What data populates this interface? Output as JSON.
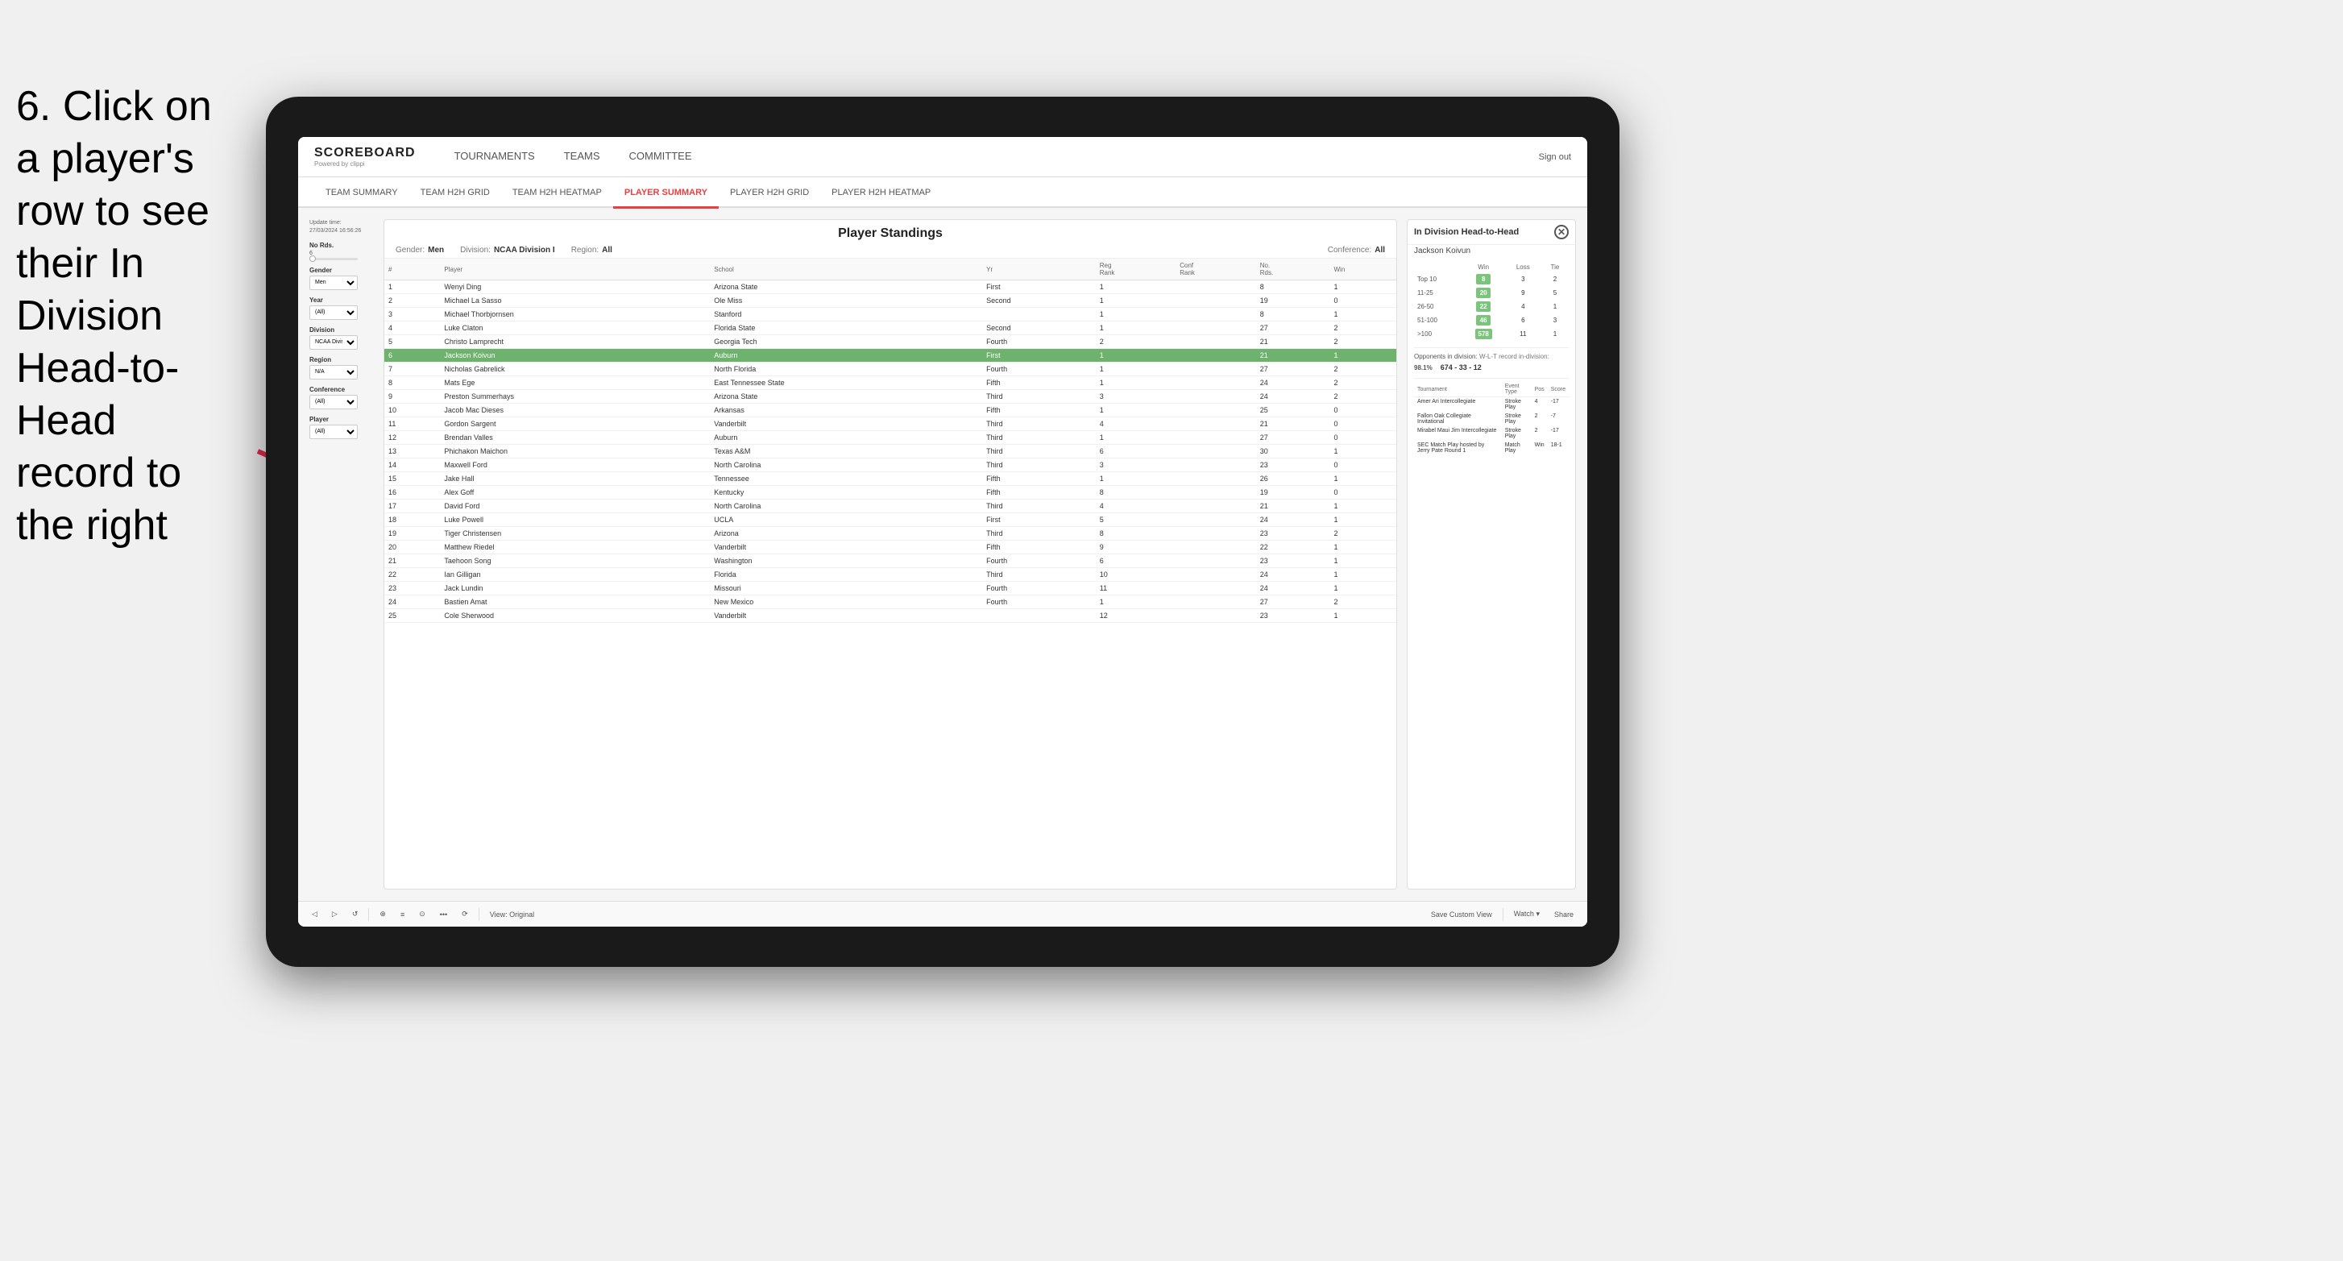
{
  "instruction": {
    "text": "6. Click on a player's row to see their In Division Head-to-Head record to the right"
  },
  "app": {
    "logo": {
      "title": "SCOREBOARD",
      "subtitle": "Powered by clippi"
    },
    "nav": {
      "items": [
        "TOURNAMENTS",
        "TEAMS",
        "COMMITTEE"
      ],
      "right": [
        "Sign out"
      ]
    },
    "sub_nav": {
      "items": [
        "TEAM SUMMARY",
        "TEAM H2H GRID",
        "TEAM H2H HEATMAP",
        "PLAYER SUMMARY",
        "PLAYER H2H GRID",
        "PLAYER H2H HEATMAP"
      ],
      "active": "PLAYER SUMMARY"
    }
  },
  "panel": {
    "title": "Player Standings",
    "update_time_label": "Update time:",
    "update_time": "27/03/2024 16:56:26",
    "filters": {
      "gender_label": "Gender:",
      "gender_value": "Men",
      "division_label": "Division:",
      "division_value": "NCAA Division I",
      "region_label": "Region:",
      "region_value": "All",
      "conference_label": "Conference:",
      "conference_value": "All"
    },
    "left_filters": {
      "no_rds_label": "No Rds.",
      "no_rds_value": "6",
      "gender_label": "Gender",
      "gender_value": "Men",
      "year_label": "Year",
      "year_value": "(All)",
      "division_label": "Division",
      "division_value": "NCAA Division I",
      "region_label": "Region",
      "region_value": "N/A",
      "conference_label": "Conference",
      "conference_value": "(All)",
      "player_label": "Player",
      "player_value": "(All)"
    },
    "table": {
      "headers": [
        "#",
        "Player",
        "School",
        "Yr",
        "Reg Rank",
        "Conf Rank",
        "No. Rds.",
        "Win"
      ],
      "rows": [
        {
          "num": 1,
          "player": "Wenyi Ding",
          "school": "Arizona State",
          "yr": "First",
          "reg_rank": 1,
          "conf_rank": "",
          "no_rds": 8,
          "win": 1
        },
        {
          "num": 2,
          "player": "Michael La Sasso",
          "school": "Ole Miss",
          "yr": "Second",
          "reg_rank": 1,
          "conf_rank": "",
          "no_rds": 19,
          "win": 0
        },
        {
          "num": 3,
          "player": "Michael Thorbjornsen",
          "school": "Stanford",
          "yr": "",
          "reg_rank": 1,
          "conf_rank": "",
          "no_rds": 8,
          "win": 1
        },
        {
          "num": 4,
          "player": "Luke Claton",
          "school": "Florida State",
          "yr": "Second",
          "reg_rank": 1,
          "conf_rank": "",
          "no_rds": 27,
          "win": 2
        },
        {
          "num": 5,
          "player": "Christo Lamprecht",
          "school": "Georgia Tech",
          "yr": "Fourth",
          "reg_rank": 2,
          "conf_rank": "",
          "no_rds": 21,
          "win": 2
        },
        {
          "num": 6,
          "player": "Jackson Koivun",
          "school": "Auburn",
          "yr": "First",
          "reg_rank": 1,
          "conf_rank": "",
          "no_rds": 21,
          "win": 1,
          "selected": true
        },
        {
          "num": 7,
          "player": "Nicholas Gabrelick",
          "school": "North Florida",
          "yr": "Fourth",
          "reg_rank": 1,
          "conf_rank": "",
          "no_rds": 27,
          "win": 2
        },
        {
          "num": 8,
          "player": "Mats Ege",
          "school": "East Tennessee State",
          "yr": "Fifth",
          "reg_rank": 1,
          "conf_rank": "",
          "no_rds": 24,
          "win": 2
        },
        {
          "num": 9,
          "player": "Preston Summerhays",
          "school": "Arizona State",
          "yr": "Third",
          "reg_rank": 3,
          "conf_rank": "",
          "no_rds": 24,
          "win": 2
        },
        {
          "num": 10,
          "player": "Jacob Mac Dieses",
          "school": "Arkansas",
          "yr": "Fifth",
          "reg_rank": 1,
          "conf_rank": "",
          "no_rds": 25,
          "win": 0
        },
        {
          "num": 11,
          "player": "Gordon Sargent",
          "school": "Vanderbilt",
          "yr": "Third",
          "reg_rank": 4,
          "conf_rank": "",
          "no_rds": 21,
          "win": 0
        },
        {
          "num": 12,
          "player": "Brendan Valles",
          "school": "Auburn",
          "yr": "Third",
          "reg_rank": 1,
          "conf_rank": "",
          "no_rds": 27,
          "win": 0
        },
        {
          "num": 13,
          "player": "Phichakon Maichon",
          "school": "Texas A&M",
          "yr": "Third",
          "reg_rank": 6,
          "conf_rank": "",
          "no_rds": 30,
          "win": 1
        },
        {
          "num": 14,
          "player": "Maxwell Ford",
          "school": "North Carolina",
          "yr": "Third",
          "reg_rank": 3,
          "conf_rank": "",
          "no_rds": 23,
          "win": 0
        },
        {
          "num": 15,
          "player": "Jake Hall",
          "school": "Tennessee",
          "yr": "Fifth",
          "reg_rank": 1,
          "conf_rank": "",
          "no_rds": 26,
          "win": 1
        },
        {
          "num": 16,
          "player": "Alex Goff",
          "school": "Kentucky",
          "yr": "Fifth",
          "reg_rank": 8,
          "conf_rank": "",
          "no_rds": 19,
          "win": 0
        },
        {
          "num": 17,
          "player": "David Ford",
          "school": "North Carolina",
          "yr": "Third",
          "reg_rank": 4,
          "conf_rank": "",
          "no_rds": 21,
          "win": 1
        },
        {
          "num": 18,
          "player": "Luke Powell",
          "school": "UCLA",
          "yr": "First",
          "reg_rank": 5,
          "conf_rank": "",
          "no_rds": 24,
          "win": 1
        },
        {
          "num": 19,
          "player": "Tiger Christensen",
          "school": "Arizona",
          "yr": "Third",
          "reg_rank": 8,
          "conf_rank": "",
          "no_rds": 23,
          "win": 2
        },
        {
          "num": 20,
          "player": "Matthew Riedel",
          "school": "Vanderbilt",
          "yr": "Fifth",
          "reg_rank": 9,
          "conf_rank": "",
          "no_rds": 22,
          "win": 1
        },
        {
          "num": 21,
          "player": "Taehoon Song",
          "school": "Washington",
          "yr": "Fourth",
          "reg_rank": 6,
          "conf_rank": "",
          "no_rds": 23,
          "win": 1
        },
        {
          "num": 22,
          "player": "Ian Gilligan",
          "school": "Florida",
          "yr": "Third",
          "reg_rank": 10,
          "conf_rank": "",
          "no_rds": 24,
          "win": 1
        },
        {
          "num": 23,
          "player": "Jack Lundin",
          "school": "Missouri",
          "yr": "Fourth",
          "reg_rank": 11,
          "conf_rank": "",
          "no_rds": 24,
          "win": 1
        },
        {
          "num": 24,
          "player": "Bastien Amat",
          "school": "New Mexico",
          "yr": "Fourth",
          "reg_rank": 1,
          "conf_rank": "",
          "no_rds": 27,
          "win": 2
        },
        {
          "num": 25,
          "player": "Cole Sherwood",
          "school": "Vanderbilt",
          "yr": "",
          "reg_rank": 12,
          "conf_rank": "",
          "no_rds": 23,
          "win": 1
        }
      ]
    }
  },
  "h2h": {
    "title": "In Division Head-to-Head",
    "player": "Jackson Koivun",
    "rank_ranges": [
      {
        "range": "Top 10",
        "win": 8,
        "loss": 3,
        "tie": 2
      },
      {
        "range": "11-25",
        "win": 20,
        "loss": 9,
        "tie": 5
      },
      {
        "range": "26-50",
        "win": 22,
        "loss": 4,
        "tie": 1
      },
      {
        "range": "51-100",
        "win": 46,
        "loss": 6,
        "tie": 3
      },
      {
        "range": ">100",
        "win": 578,
        "loss": 11,
        "tie": 1
      }
    ],
    "col_headers": [
      "Win",
      "Loss",
      "Tie"
    ],
    "opponents_label": "Opponents in division:",
    "wl_label": "W-L-T record in-division:",
    "opponents_pct": "98.1%",
    "wl_record": "674 - 33 - 12",
    "tournaments": {
      "headers": [
        "Tournament",
        "Event Type",
        "Pos",
        "Score"
      ],
      "rows": [
        {
          "tournament": "Amer Ari Intercollegiate",
          "event_type": "Stroke Play",
          "pos": 4,
          "score": "-17"
        },
        {
          "tournament": "Fallon Oak Collegiate Invitational",
          "event_type": "Stroke Play",
          "pos": 2,
          "score": "-7"
        },
        {
          "tournament": "Mirabel Maui Jim Intercollegiate",
          "event_type": "Stroke Play",
          "pos": 2,
          "score": "-17"
        },
        {
          "tournament": "SEC Match Play hosted by Jerry Pate Round 1",
          "event_type": "Match Play",
          "pos": "Win",
          "score": "18-1"
        }
      ]
    }
  },
  "toolbar": {
    "buttons": [
      "◁",
      "▷",
      "⟳",
      "⊕",
      "≡",
      "⊙",
      "•",
      "↺"
    ],
    "view_original": "View: Original",
    "save_custom": "Save Custom View",
    "watch": "Watch ▾",
    "share": "Share"
  },
  "colors": {
    "active_tab": "#e84040",
    "selected_row": "#6db36d",
    "win_cell": "#7bc47b",
    "arrow": "#e8294a"
  }
}
